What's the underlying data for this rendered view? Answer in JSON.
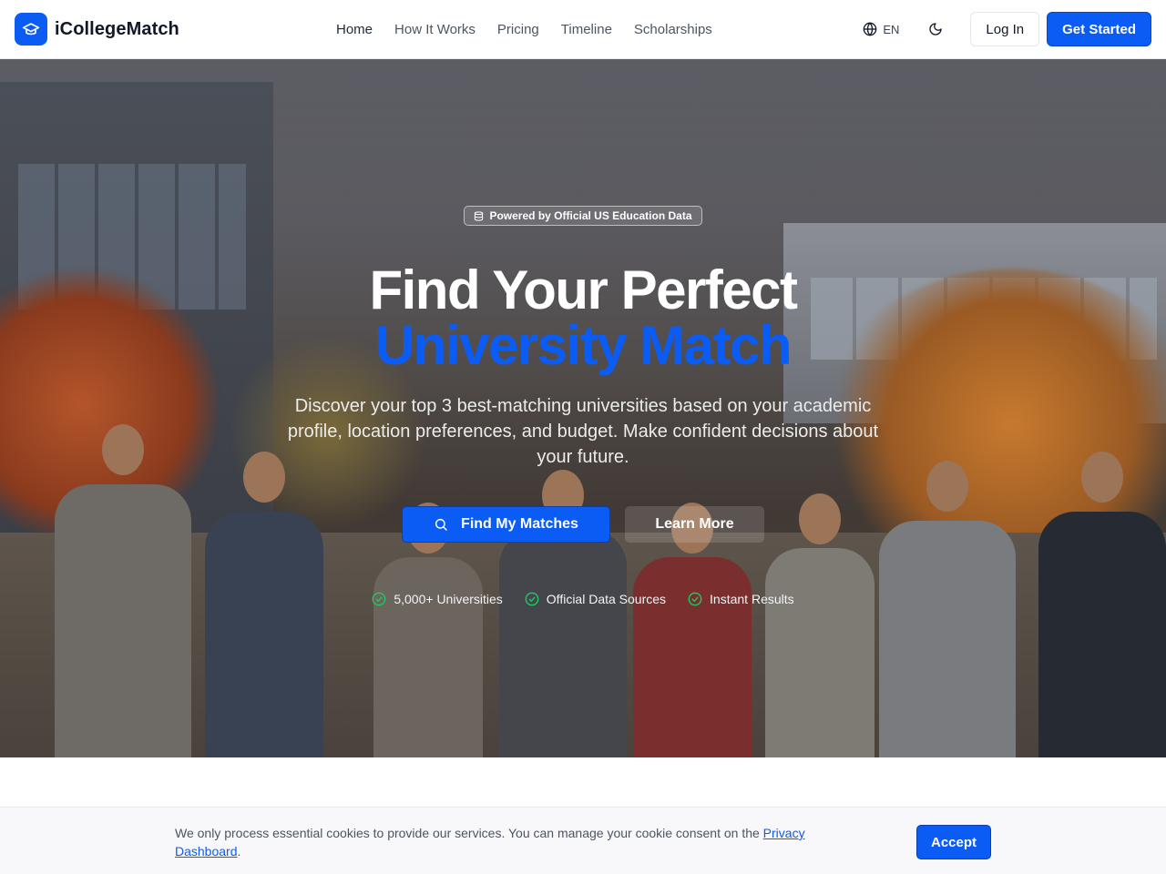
{
  "header": {
    "brand": "iCollegeMatch",
    "nav": [
      {
        "label": "Home"
      },
      {
        "label": "How It Works"
      },
      {
        "label": "Pricing"
      },
      {
        "label": "Timeline"
      },
      {
        "label": "Scholarships"
      }
    ],
    "language": "EN",
    "login_label": "Log In",
    "cta_label": "Get Started"
  },
  "hero": {
    "badge": "Powered by Official US Education Data",
    "title_line1": "Find Your Perfect",
    "title_line2": "University Match",
    "subtitle": "Discover your top 3 best-matching universities based on your academic profile, location preferences, and budget. Make confident decisions about your future.",
    "primary_button": "Find My Matches",
    "secondary_button": "Learn More",
    "features": [
      {
        "label": "5,000+ Universities"
      },
      {
        "label": "Official Data Sources"
      },
      {
        "label": "Instant Results"
      }
    ]
  },
  "cookie": {
    "text": "We only process essential cookies to provide our services. You can manage your cookie consent on the ",
    "link": "Privacy Dashboard",
    "suffix": ".",
    "accept_label": "Accept"
  },
  "colors": {
    "brand": "#0a5cf5",
    "check": "#22c55e"
  },
  "icons": {
    "logo": "graduation-cap-icon",
    "language": "globe-icon",
    "theme": "moon-icon",
    "badge": "database-icon",
    "search": "search-icon",
    "feature": "check-circle-icon"
  }
}
